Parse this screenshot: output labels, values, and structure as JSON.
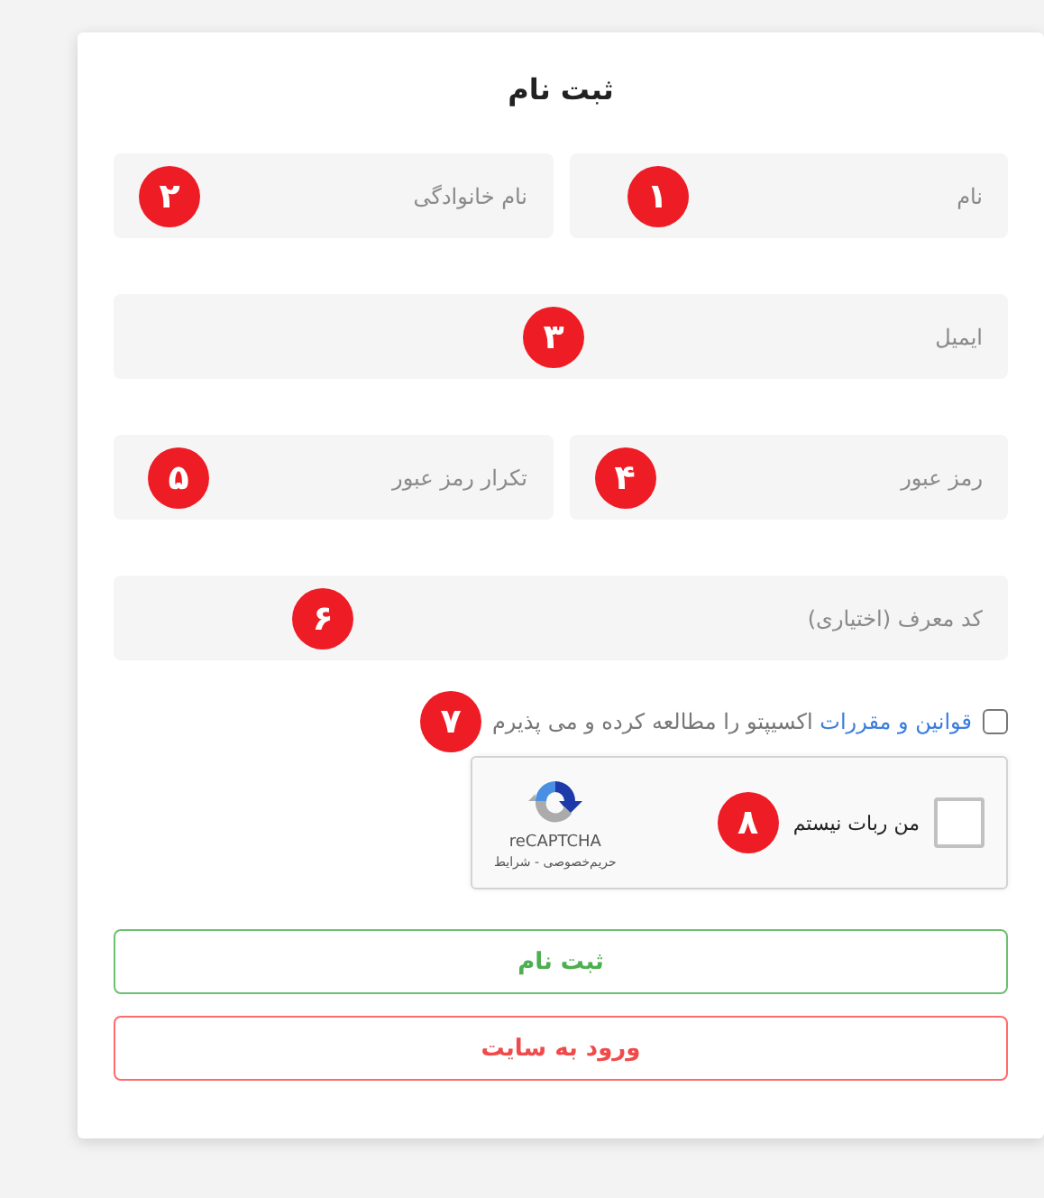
{
  "title": "ثبت نام",
  "field_rows": [
    [
      {
        "placeholder": "نام",
        "badge": "۱"
      },
      {
        "placeholder": "نام خانوادگی",
        "badge": "۲"
      }
    ],
    [
      {
        "placeholder": "ایمیل",
        "badge": "۳"
      }
    ],
    [
      {
        "placeholder": "رمز عبور",
        "badge": "۴"
      },
      {
        "placeholder": "تکرار رمز عبور",
        "badge": "۵"
      }
    ],
    [
      {
        "placeholder": "کد معرف (اختیاری)",
        "badge": "۶"
      }
    ]
  ],
  "terms": {
    "checked": false,
    "link": "قوانین و مقررات",
    "text": "اکسیپتو را مطالعه کرده و می پذیرم",
    "badge": "۷"
  },
  "captcha": {
    "checked": false,
    "label": "من ربات نیستم",
    "brand": "reCAPTCHA",
    "links": "حریم‌خصوصی - شرایط",
    "badge": "۸"
  },
  "buttons": [
    {
      "label": "ثبت نام",
      "kind": "primary"
    },
    {
      "label": "ورود به سایت",
      "kind": "secondary"
    }
  ]
}
